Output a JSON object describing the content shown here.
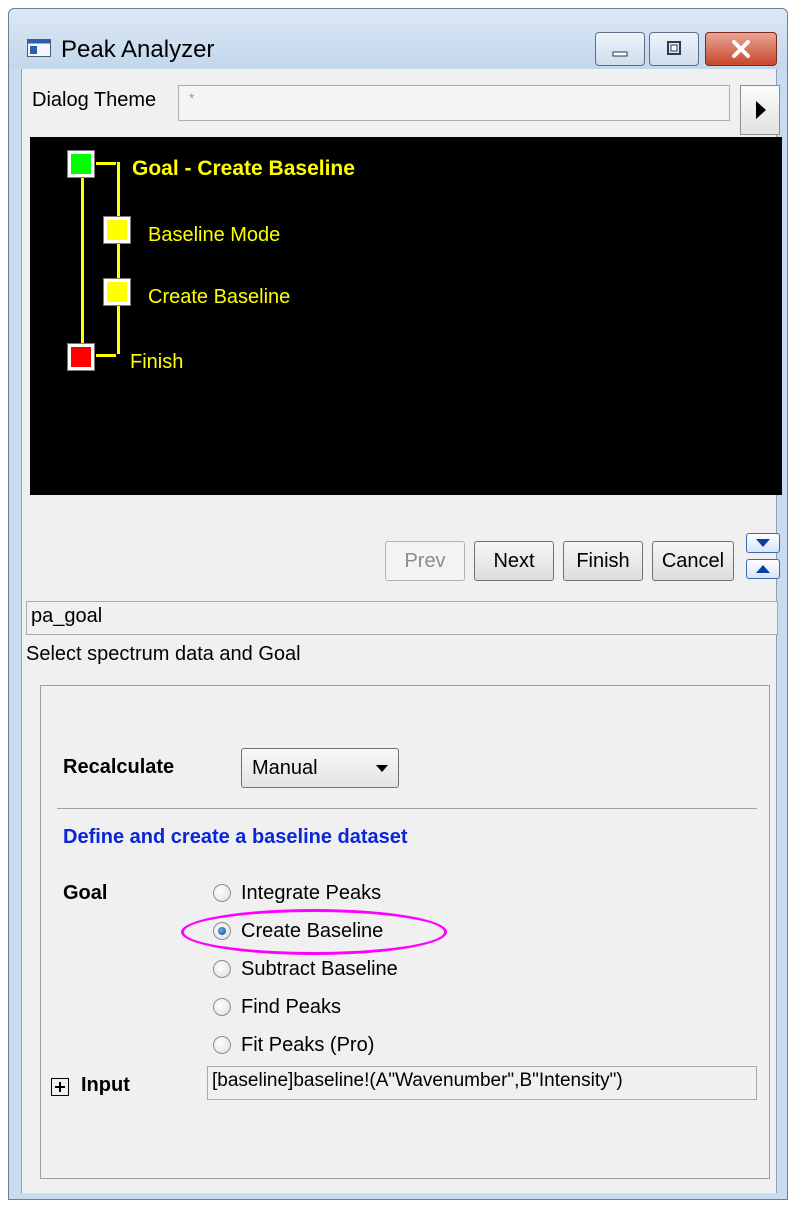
{
  "window": {
    "title": "Peak Analyzer",
    "controls": [
      "minimize-icon",
      "restore-icon",
      "close-icon"
    ]
  },
  "theme": {
    "label": "Dialog Theme",
    "value": "*"
  },
  "tree": {
    "background": "#000000",
    "line_color": "#ffff00",
    "nodes": [
      {
        "label": "Goal - Create Baseline",
        "color": "#00ff00",
        "bold": true
      },
      {
        "label": "Baseline Mode",
        "color": "#ffff00",
        "bold": false
      },
      {
        "label": "Create Baseline",
        "color": "#ffff00",
        "bold": false
      },
      {
        "label": "Finish",
        "color": "#ff0000",
        "bold": false
      }
    ]
  },
  "nav": {
    "prev": "Prev",
    "next": "Next",
    "finish": "Finish",
    "cancel": "Cancel"
  },
  "page_name": "pa_goal",
  "description": "Select spectrum data and Goal",
  "recalculate": {
    "label": "Recalculate",
    "value": "Manual"
  },
  "section_title": "Define and create a baseline dataset",
  "goal": {
    "label": "Goal",
    "options": [
      "Integrate Peaks",
      "Create Baseline",
      "Subtract Baseline",
      "Find Peaks",
      "Fit Peaks (Pro)"
    ],
    "selected": "Create Baseline"
  },
  "input": {
    "label": "Input",
    "value": "[baseline]baseline!(A\"Wavenumber\",B\"Intensity\")"
  },
  "colors": {
    "section_title": "#0b25d8",
    "highlight": "#ff00ff"
  }
}
